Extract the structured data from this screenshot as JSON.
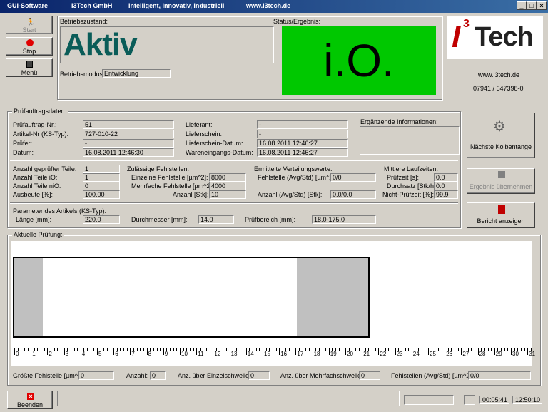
{
  "titlebar": {
    "app": "GUI-Software",
    "company": "I3Tech GmbH",
    "slogan": "Intelligent, Innovativ, Industriell",
    "url": "www.i3tech.de"
  },
  "left_buttons": {
    "start": "Start",
    "stop": "Stop",
    "menu": "Menü"
  },
  "status": {
    "betriebszustand_label": "Betriebszustand:",
    "betriebszustand_value": "Aktiv",
    "betriebsmodus_label": "Betriebsmodus:",
    "betriebsmodus_value": "Entwicklung",
    "ergebnis_label": "Status/Ergebnis:",
    "ergebnis_value": "i.O.",
    "ergebnis_color": "#00c800"
  },
  "logo": {
    "text_i": "I",
    "text_3": "3",
    "text_tech": "Tech",
    "url": "www.i3tech.de",
    "phone": "07941 / 647398-0",
    "brand_color": "#c00000"
  },
  "pruefauftrag": {
    "title": "Prüfauftragsdaten:",
    "rows_left": [
      {
        "label": "Prüfauftrag-Nr.:",
        "value": "51"
      },
      {
        "label": "Artikel-Nr (KS-Typ):",
        "value": "727-010-22"
      },
      {
        "label": "Prüfer:",
        "value": "-"
      },
      {
        "label": "Datum:",
        "value": "16.08.2011 12:46:30"
      }
    ],
    "rows_mid": [
      {
        "label": "Lieferant:",
        "value": "-"
      },
      {
        "label": "Lieferschein:",
        "value": "-"
      },
      {
        "label": "Lieferschein-Datum:",
        "value": "16.08.2011 12:46:27"
      },
      {
        "label": "Wareneingangs-Datum:",
        "value": "16.08.2011 12:46:27"
      }
    ],
    "ergaenzende_label": "Ergänzende Informationen:",
    "ergaenzende_value": ""
  },
  "teile": {
    "rows": [
      {
        "label": "Anzahl geprüfter Teile:",
        "value": "1"
      },
      {
        "label": "Anzahl Teile iO:",
        "value": "1"
      },
      {
        "label": "Anzahl Teile niO:",
        "value": "0"
      },
      {
        "label": "Ausbeute [%]:",
        "value": "100.00"
      }
    ]
  },
  "zulaessig": {
    "title": "Zulässige Fehlstellen:",
    "rows": [
      {
        "label": "Einzelne Fehlstelle [µm^2]:",
        "value": "8000"
      },
      {
        "label": "Mehrfache Fehlstelle [µm^2]:",
        "value": "4000"
      },
      {
        "label": "Anzahl [Stk]:",
        "value": "10"
      }
    ]
  },
  "verteilung": {
    "title": "Ermittelte Verteilungswerte:",
    "rows": [
      {
        "label": "Fehlstelle (Avg/Std) [µm^2]:",
        "value": "0/0"
      },
      {
        "label": "Anzahl (Avg/Std) [Stk]:",
        "value": "0.0/0.0"
      }
    ]
  },
  "laufzeiten": {
    "title": "Mittlere Laufzeiten:",
    "rows": [
      {
        "label": "Prüfzeit [s]:",
        "value": "0.0"
      },
      {
        "label": "Durchsatz [Stk/h]:",
        "value": "0.0"
      },
      {
        "label": "Nicht-Prüfzeit [%]:",
        "value": "99.9"
      }
    ]
  },
  "parameter": {
    "title": "Parameter des Artikels (KS-Typ):",
    "laenge_label": "Länge [mm]:",
    "laenge_value": "220.0",
    "durchmesser_label": "Durchmesser [mm]:",
    "durchmesser_value": "14.0",
    "pruefbereich_label": "Prüfbereich [mm]:",
    "pruefbereich_value": "18.0-175.0"
  },
  "right_buttons": {
    "naechste": "Nächste Kolbentange",
    "ergebnis": "Ergebnis übernehmen",
    "bericht": "Bericht anzeigen"
  },
  "aktuelle": {
    "title": "Aktuelle Prüfung:",
    "ruler_labels": [
      "0",
      "1",
      "2",
      "3",
      "4",
      "5",
      "6",
      "7",
      "8",
      "9",
      "10",
      "11",
      "12",
      "13",
      "14",
      "15",
      "16",
      "17",
      "18",
      "19",
      "20",
      "21",
      "22",
      "23",
      "24",
      "25",
      "26",
      "27",
      "28",
      "29",
      "30",
      "31"
    ],
    "bottom": [
      {
        "label": "Größte Fehlstelle [µm^2]:",
        "value": "0"
      },
      {
        "label": "Anzahl:",
        "value": "0"
      },
      {
        "label": "Anz. über Einzelschwelle:",
        "value": "0"
      },
      {
        "label": "Anz. über Mehrfachschwelle:",
        "value": "0"
      },
      {
        "label": "Fehlstellen (Avg/Std) [µm^2]:",
        "value": "0/0"
      }
    ]
  },
  "footer": {
    "beenden": "Beenden",
    "time1": "00:05:41",
    "time2": "12:50:10"
  }
}
